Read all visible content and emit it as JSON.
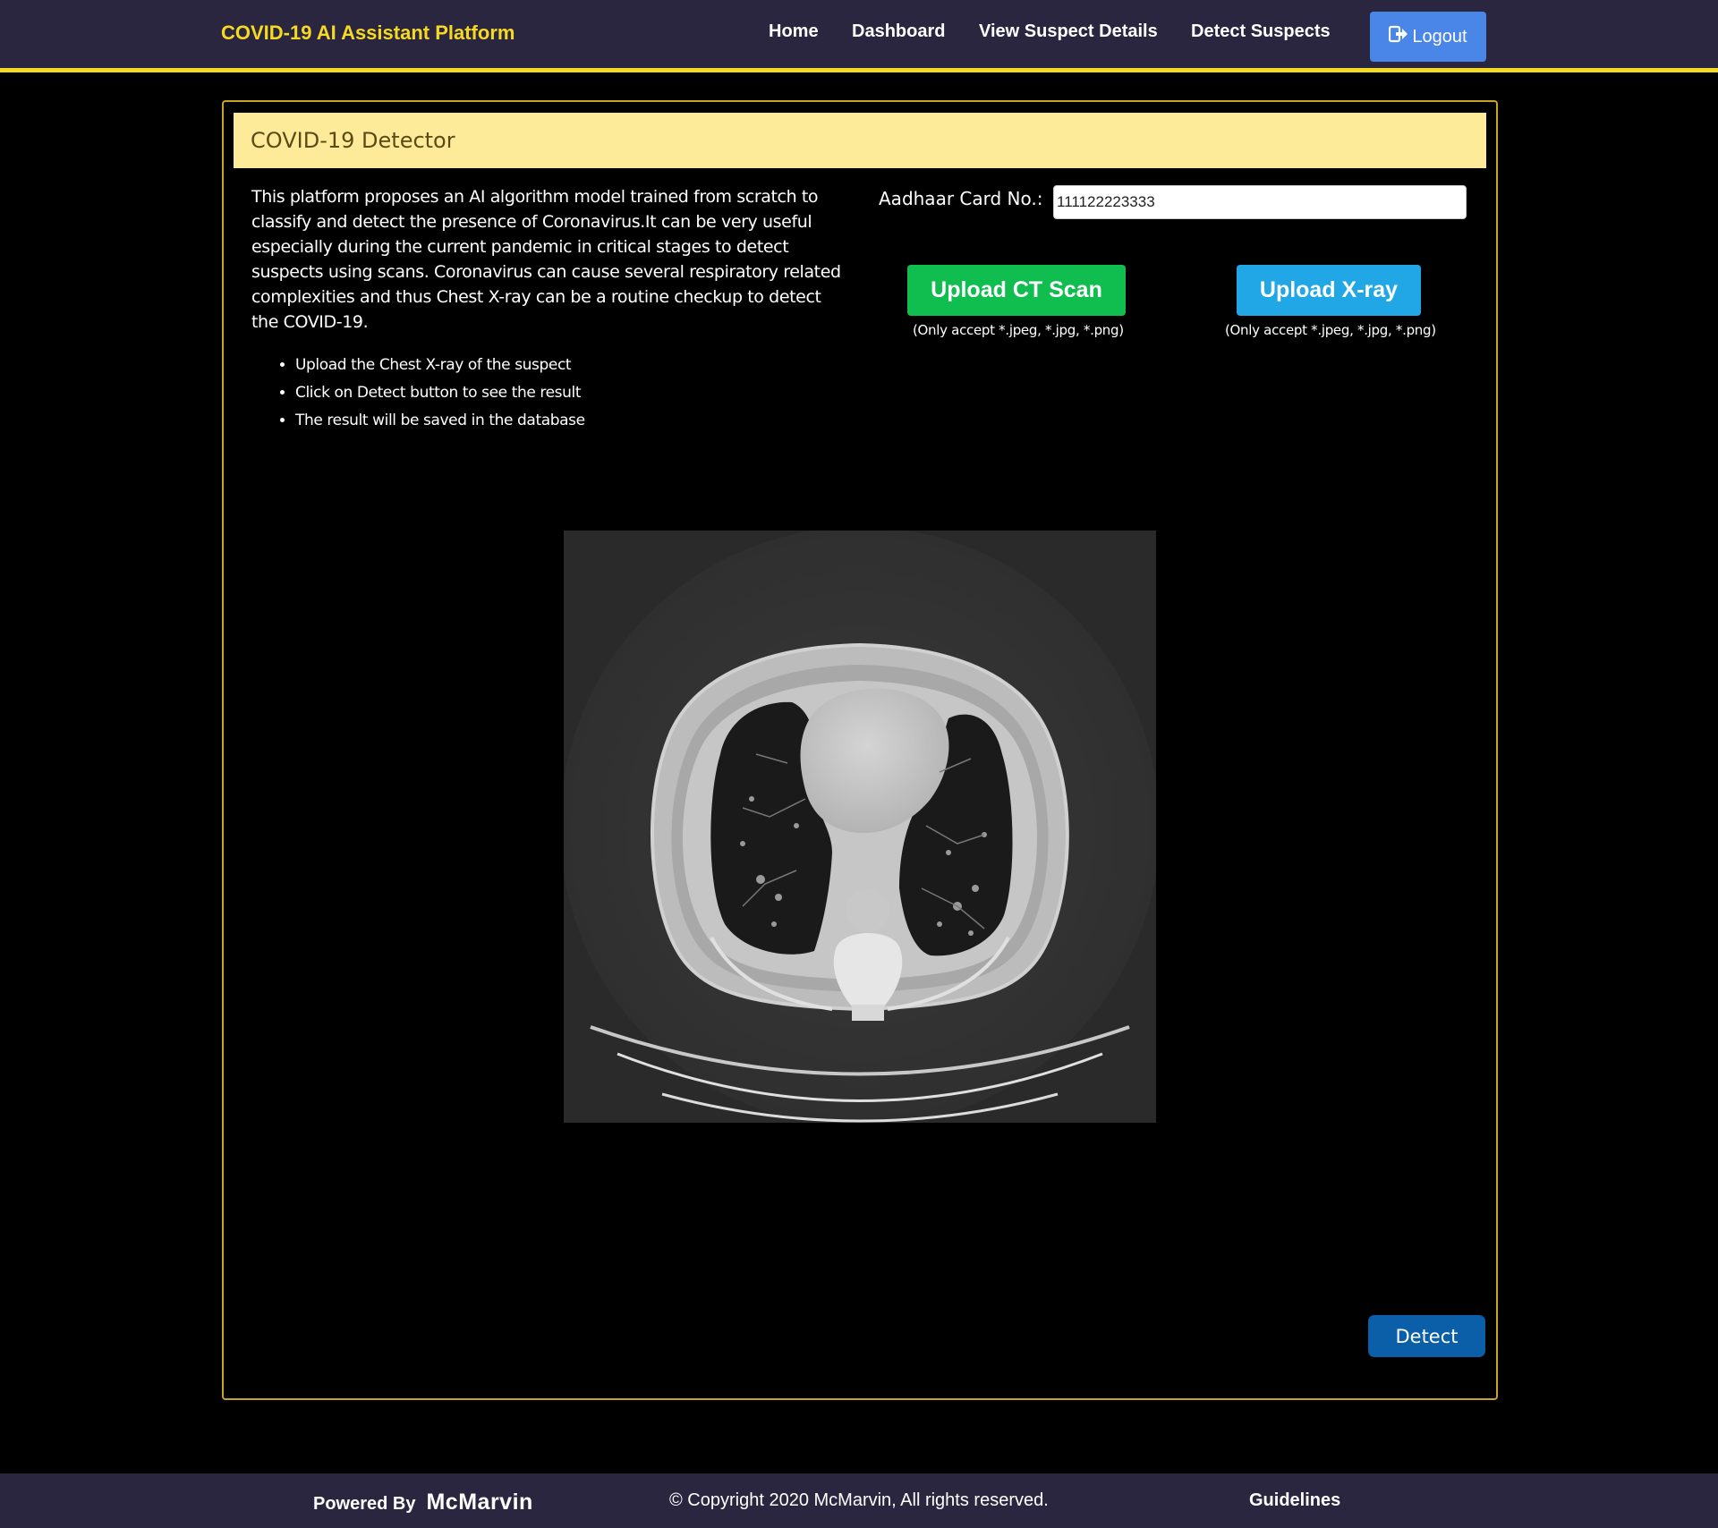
{
  "navbar": {
    "brand": "COVID-19 AI Assistant Platform",
    "links": [
      "Home",
      "Dashboard",
      "View Suspect Details",
      "Detect Suspects"
    ],
    "logout_label": "Logout"
  },
  "card": {
    "title": "COVID-19 Detector",
    "description": "This platform proposes an AI algorithm model trained from scratch to classify and detect the presence of Coronavirus.It can be very useful especially during the current pandemic in critical stages to detect suspects using scans. Coronavirus can cause several respiratory related complexities and thus Chest X-ray can be a routine checkup to detect the COVID-19.",
    "steps": [
      "Upload the Chest X-ray of the suspect",
      "Click on Detect button to see the result",
      "The result will be saved in the database"
    ],
    "aadhaar_label": "Aadhaar Card No.:",
    "aadhaar_value": "111122223333",
    "upload_ct_label": "Upload CT Scan",
    "upload_xray_label": "Upload X-ray",
    "accept_note_ct": "(Only accept *.jpeg, *.jpg, *.png)",
    "accept_note_xray": "(Only accept *.jpeg, *.jpg, *.png)",
    "detect_label": "Detect"
  },
  "footer": {
    "powered_by": "Powered By",
    "logo": "McMarvin",
    "copyright": "© Copyright 2020 McMarvin, All rights reserved.",
    "guidelines": "Guidelines"
  },
  "colors": {
    "navbar_bg": "#2b2640",
    "brand": "#f5d922",
    "card_header_bg": "#fdeb9a",
    "upload_ct": "#0fbe4f",
    "upload_xray": "#22a7e6",
    "logout": "#4a86e8",
    "detect": "#0a5fa8"
  }
}
